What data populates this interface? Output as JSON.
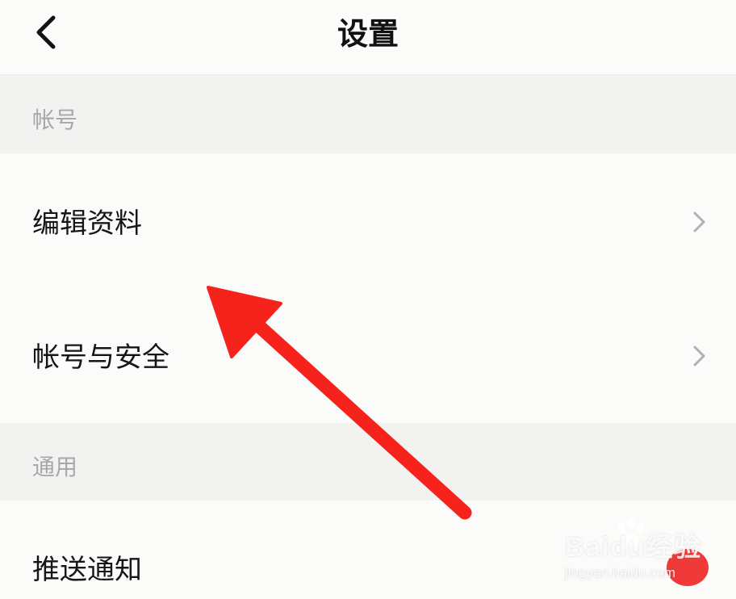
{
  "header": {
    "title": "设置",
    "back_icon": "chevron-left-icon"
  },
  "sections": [
    {
      "label": "帐号",
      "items": [
        {
          "label": "编辑资料"
        },
        {
          "label": "帐号与安全"
        }
      ]
    },
    {
      "label": "通用",
      "items": [
        {
          "label": "推送通知"
        }
      ]
    }
  ],
  "overlay": {
    "arrow_color": "#f5231c"
  },
  "watermark": {
    "brand": "Baidu经验",
    "url": "jingyan.baidu.com"
  },
  "colors": {
    "background": "#fbfbf9",
    "section_bg": "#f2f2f0",
    "section_text": "#a8a8a8",
    "chevron": "#b0b0b0"
  }
}
